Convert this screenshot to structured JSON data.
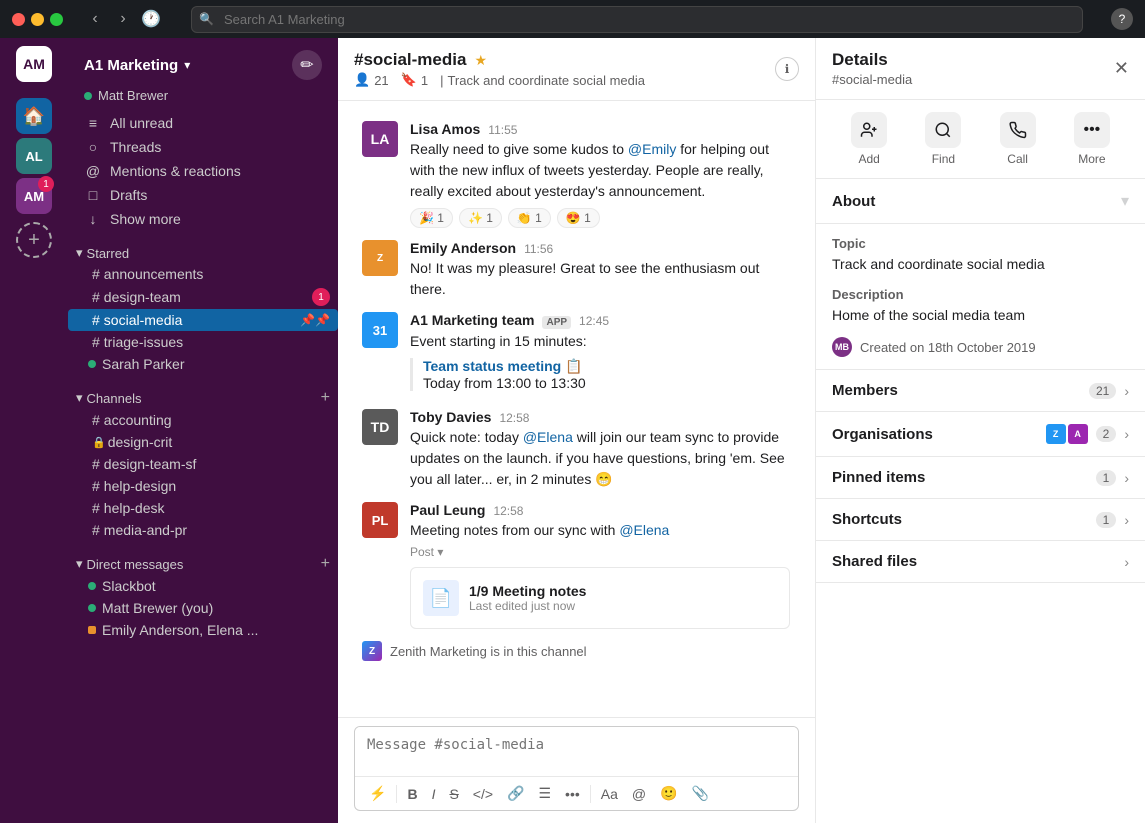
{
  "titlebar": {
    "search_placeholder": "Search A1 Marketing"
  },
  "workspace": {
    "name": "A1 Marketing",
    "user": "Matt Brewer",
    "initials": "AM"
  },
  "sidebar": {
    "nav_items": [
      {
        "id": "all-unread",
        "label": "All unread",
        "icon": "≡"
      },
      {
        "id": "threads",
        "label": "Threads",
        "icon": "○"
      },
      {
        "id": "mentions",
        "label": "Mentions & reactions",
        "icon": "○"
      },
      {
        "id": "drafts",
        "label": "Drafts",
        "icon": "□"
      },
      {
        "id": "show-more",
        "label": "Show more",
        "icon": "↓"
      }
    ],
    "starred": {
      "label": "Starred",
      "channels": [
        {
          "name": "announcements",
          "type": "public"
        },
        {
          "name": "design-team",
          "type": "public",
          "badge": 1
        },
        {
          "name": "social-media",
          "type": "public",
          "active": true,
          "pinned": true
        },
        {
          "name": "triage-issues",
          "type": "public"
        },
        {
          "name": "Sarah Parker",
          "type": "dm",
          "online": true
        }
      ]
    },
    "channels": {
      "label": "Channels",
      "items": [
        {
          "name": "accounting",
          "type": "public"
        },
        {
          "name": "design-crit",
          "type": "private"
        },
        {
          "name": "design-team-sf",
          "type": "public"
        },
        {
          "name": "help-design",
          "type": "public"
        },
        {
          "name": "help-desk",
          "type": "public"
        },
        {
          "name": "media-and-pr",
          "type": "public"
        }
      ]
    },
    "direct_messages": {
      "label": "Direct messages",
      "items": [
        {
          "name": "Slackbot",
          "type": "bot",
          "online": true
        },
        {
          "name": "Matt Brewer (you)",
          "type": "user",
          "online": true
        },
        {
          "name": "Emily Anderson, Elena ...",
          "type": "app"
        }
      ]
    }
  },
  "channel": {
    "name": "#social-media",
    "members": 21,
    "bookmarks": 1,
    "description": "Track and coordinate social media"
  },
  "messages": [
    {
      "id": "msg1",
      "author": "Lisa Amos",
      "time": "11:55",
      "avatar_initials": "LA",
      "text": "Really need to give some kudos to @Emily for helping out with the new influx of tweets yesterday. People are really, really excited about yesterday's announcement.",
      "mention": "@Emily",
      "reactions": [
        {
          "emoji": "🎉",
          "count": 1
        },
        {
          "emoji": "✨",
          "count": 1
        },
        {
          "emoji": "👏",
          "count": 1
        },
        {
          "emoji": "😍",
          "count": 1
        }
      ]
    },
    {
      "id": "msg2",
      "author": "Emily Anderson",
      "time": "11:56",
      "avatar_initials": "Z",
      "text": "No! It was my pleasure! Great to see the enthusiasm out there."
    },
    {
      "id": "msg3",
      "author": "A1 Marketing team",
      "time": "12:45",
      "avatar_initials": "31",
      "app": true,
      "text": "Event starting in 15 minutes:",
      "quote_link": "Team status meeting 📋",
      "quote_text": "Today from 13:00 to 13:30"
    },
    {
      "id": "msg4",
      "author": "Toby Davies",
      "time": "12:58",
      "avatar_initials": "TD",
      "text": "Quick note: today @Elena will join our team sync to provide updates on the launch. if you have questions, bring 'em. See you all later... er, in 2 minutes 😁",
      "mention": "@Elena"
    },
    {
      "id": "msg5",
      "author": "Paul Leung",
      "time": "12:58",
      "avatar_initials": "PL",
      "text": "Meeting notes from our sync with @Elena",
      "mention": "@Elena",
      "post_label": "Post",
      "post_title": "1/9 Meeting notes",
      "post_subtitle": "Last edited just now"
    }
  ],
  "system_message": "Zenith Marketing is in this channel",
  "input_placeholder": "Message #social-media",
  "details": {
    "title": "Details",
    "channel_ref": "#social-media",
    "actions": [
      {
        "id": "add",
        "icon": "👤+",
        "label": "Add"
      },
      {
        "id": "find",
        "icon": "🔍",
        "label": "Find"
      },
      {
        "id": "call",
        "icon": "📞",
        "label": "Call"
      },
      {
        "id": "more",
        "icon": "•••",
        "label": "More"
      }
    ],
    "about": {
      "title": "About",
      "topic_label": "Topic",
      "topic_value": "Track and coordinate social media",
      "description_label": "Description",
      "description_value": "Home of the social media team",
      "created_text": "Created on 18th October 2019"
    },
    "sections": [
      {
        "id": "members",
        "label": "Members",
        "count": 21
      },
      {
        "id": "organisations",
        "label": "Organisations",
        "count": 2
      },
      {
        "id": "pinned-items",
        "label": "Pinned items",
        "count": 1
      },
      {
        "id": "shortcuts",
        "label": "Shortcuts",
        "count": 1
      },
      {
        "id": "shared-files",
        "label": "Shared files",
        "count": null
      }
    ]
  }
}
